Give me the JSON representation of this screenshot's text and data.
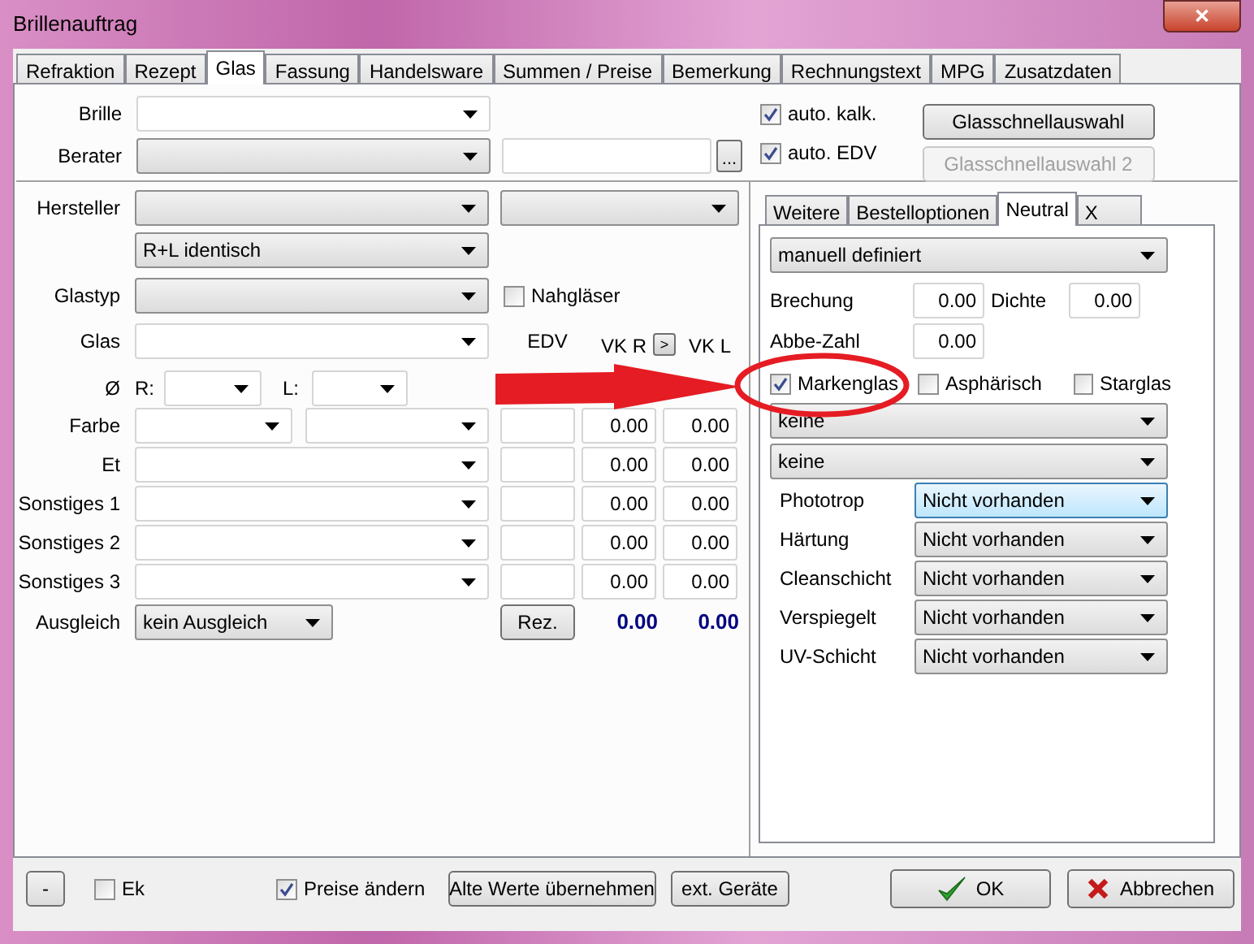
{
  "window": {
    "title": "Brillenauftrag",
    "close": "✕"
  },
  "tabs": [
    {
      "label": "Refraktion",
      "selected": false
    },
    {
      "label": "Rezept",
      "selected": false
    },
    {
      "label": "Glas",
      "selected": true
    },
    {
      "label": "Fassung",
      "selected": false
    },
    {
      "label": "Handelsware",
      "selected": false
    },
    {
      "label": "Summen / Preise",
      "selected": false
    },
    {
      "label": "Bemerkung",
      "selected": false
    },
    {
      "label": "Rechnungstext",
      "selected": false
    },
    {
      "label": "MPG",
      "selected": false
    },
    {
      "label": "Zusatzdaten",
      "selected": false
    }
  ],
  "header": {
    "brille_label": "Brille",
    "berater_label": "Berater",
    "browse_button": "...",
    "options": [
      {
        "label": "auto. kalk.",
        "checked": true
      },
      {
        "label": "auto. EDV",
        "checked": true
      }
    ],
    "quick_buttons": [
      {
        "label": "Glasschnellauswahl",
        "disabled": false
      },
      {
        "label": "Glasschnellauswahl 2",
        "disabled": true
      }
    ]
  },
  "glass": {
    "hersteller_label": "Hersteller",
    "pairing": "R+L identisch",
    "glastyp_label": "Glastyp",
    "near": {
      "label": "Nahgläser",
      "checked": false
    },
    "glas_label": "Glas",
    "edv_header": "EDV",
    "vk_r_header": "VK R",
    "swap_button": ">",
    "vk_l_header": "VK L",
    "diameter": {
      "label": "Ø",
      "r_label": "R:",
      "l_label": "L:"
    },
    "rows": [
      {
        "label": "Farbe",
        "kind": "split",
        "vk_r": "0.00",
        "vk_l": "0.00"
      },
      {
        "label": "Et",
        "kind": "single",
        "vk_r": "0.00",
        "vk_l": "0.00"
      },
      {
        "label": "Sonstiges 1",
        "kind": "single",
        "vk_r": "0.00",
        "vk_l": "0.00"
      },
      {
        "label": "Sonstiges 2",
        "kind": "single",
        "vk_r": "0.00",
        "vk_l": "0.00"
      },
      {
        "label": "Sonstiges 3",
        "kind": "single",
        "vk_r": "0.00",
        "vk_l": "0.00"
      }
    ],
    "ausgleich_label": "Ausgleich",
    "ausgleich_value": "kein Ausgleich",
    "rez_button": "Rez.",
    "total_r": "0.00",
    "total_l": "0.00"
  },
  "sub_tabs": [
    {
      "label": "Weitere",
      "selected": false
    },
    {
      "label": "Bestelloptionen",
      "selected": false
    },
    {
      "label": "Neutral",
      "selected": true
    },
    {
      "label": "X",
      "selected": false
    }
  ],
  "neutral": {
    "preset": "manuell definiert",
    "fields": [
      {
        "label": "Brechung",
        "value": "0.00"
      },
      {
        "label": "Dichte",
        "value": "0.00"
      },
      {
        "label": "Abbe-Zahl",
        "value": "0.00"
      }
    ],
    "flags": [
      {
        "label": "Markenglas",
        "checked": true
      },
      {
        "label": "Asphärisch",
        "checked": false
      },
      {
        "label": "Starglas",
        "checked": false
      }
    ],
    "selects": [
      "keine",
      "keine"
    ],
    "coatings": [
      {
        "label": "Phototrop",
        "value": "Nicht vorhanden",
        "focused": true
      },
      {
        "label": "Härtung",
        "value": "Nicht vorhanden",
        "focused": false
      },
      {
        "label": "Cleanschicht",
        "value": "Nicht vorhanden",
        "focused": false
      },
      {
        "label": "Verspiegelt",
        "value": "Nicht vorhanden",
        "focused": false
      },
      {
        "label": "UV-Schicht",
        "value": "Nicht vorhanden",
        "focused": false
      }
    ]
  },
  "footer": {
    "minus_button": "-",
    "ek": {
      "label": "Ek",
      "checked": false
    },
    "preise": {
      "label": "Preise ändern",
      "checked": true
    },
    "buttons": [
      {
        "label": "Alte Werte übernehmen",
        "kind": "plain"
      },
      {
        "label": "ext. Geräte",
        "kind": "plain"
      },
      {
        "label": "OK",
        "kind": "ok"
      },
      {
        "label": "Abbrechen",
        "kind": "cancel"
      }
    ]
  }
}
